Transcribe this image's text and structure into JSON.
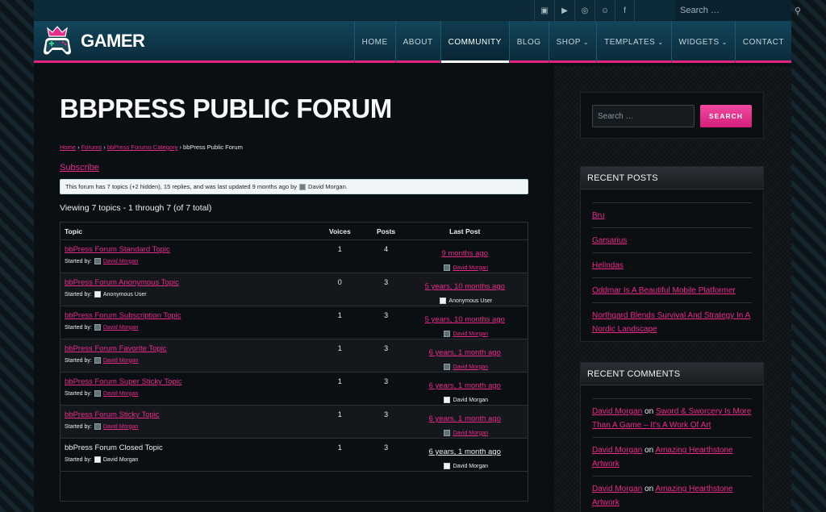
{
  "topbar": {
    "social": [
      {
        "icon": "twitch-icon",
        "glyph": "▣"
      },
      {
        "icon": "youtube-icon",
        "glyph": "▶"
      },
      {
        "icon": "steam-icon",
        "glyph": "◎"
      },
      {
        "icon": "discord-icon",
        "glyph": "☺"
      },
      {
        "icon": "facebook-icon",
        "glyph": "f"
      }
    ],
    "search_placeholder": "Search …"
  },
  "header": {
    "logo_text": "GAMER",
    "nav": [
      {
        "label": "HOME",
        "caret": false,
        "active": false
      },
      {
        "label": "ABOUT",
        "caret": false,
        "active": false
      },
      {
        "label": "COMMUNITY",
        "caret": false,
        "active": true
      },
      {
        "label": "BLOG",
        "caret": false,
        "active": false
      },
      {
        "label": "SHOP",
        "caret": true,
        "active": false
      },
      {
        "label": "TEMPLATES",
        "caret": true,
        "active": false
      },
      {
        "label": "WIDGETS",
        "caret": true,
        "active": false
      },
      {
        "label": "CONTACT",
        "caret": false,
        "active": false
      }
    ]
  },
  "main": {
    "title": "BBPRESS PUBLIC FORUM",
    "breadcrumb": {
      "home": "Home",
      "forums": "Forums",
      "category": "bbPress Forums Category",
      "current": "bbPress Public Forum",
      "sep": "›"
    },
    "subscribe": "Subscribe",
    "notice": {
      "text": "This forum has 7 topics (+2 hidden), 15 replies, and was last updated 9 months ago by",
      "author": "David Morgan",
      "end": "."
    },
    "viewing": "Viewing 7 topics - 1 through 7 (of 7 total)",
    "table": {
      "headers": {
        "topic": "Topic",
        "voices": "Voices",
        "posts": "Posts",
        "last": "Last Post"
      },
      "started_label": "Started by:",
      "rows": [
        {
          "title": "bbPress Forum Standard Topic",
          "title_link": true,
          "author": "David Morgan",
          "author_link": true,
          "voices": "1",
          "posts": "4",
          "last": "9 months ago",
          "last_link": true,
          "last_author": "David Morgan",
          "last_author_link": true
        },
        {
          "title": "bbPress Forum Anonymous Topic",
          "title_link": true,
          "author": "Anonymous User",
          "author_link": false,
          "voices": "0",
          "posts": "3",
          "last": "5 years, 10 months ago",
          "last_link": true,
          "last_author": "Anonymous User",
          "last_author_link": false
        },
        {
          "title": "bbPress Forum Subscription Topic",
          "title_link": true,
          "author": "David Morgan",
          "author_link": true,
          "voices": "1",
          "posts": "3",
          "last": "5 years, 10 months ago",
          "last_link": true,
          "last_author": "David Morgan",
          "last_author_link": true
        },
        {
          "title": "bbPress Forum Favorite Topic",
          "title_link": true,
          "author": "David Morgan",
          "author_link": true,
          "voices": "1",
          "posts": "3",
          "last": "6 years, 1 month ago",
          "last_link": true,
          "last_author": "David Morgan",
          "last_author_link": true
        },
        {
          "title": "bbPress Forum Super Sticky Topic",
          "title_link": true,
          "author": "David Morgan",
          "author_link": true,
          "voices": "1",
          "posts": "3",
          "last": "6 years, 1 month ago",
          "last_link": true,
          "last_author": "David Morgan",
          "last_author_link": false
        },
        {
          "title": "bbPress Forum Sticky Topic",
          "title_link": true,
          "author": "David Morgan",
          "author_link": true,
          "voices": "1",
          "posts": "3",
          "last": "6 years, 1 month ago",
          "last_link": true,
          "last_author": "David Morgan",
          "last_author_link": true
        },
        {
          "title": "bbPress Forum Closed Topic",
          "title_link": false,
          "author": "David Morgan",
          "author_link": false,
          "voices": "1",
          "posts": "3",
          "last": "6 years, 1 month ago",
          "last_link": false,
          "last_author": "David Morgan",
          "last_author_link": false
        }
      ]
    }
  },
  "sidebar": {
    "search_placeholder": "Search …",
    "search_button": "SEARCH",
    "recent_posts": {
      "title": "RECENT POSTS",
      "items": [
        "Bru",
        "Garsarius",
        "Helindas",
        "Oddmar Is A Beautiful Mobile Platformer",
        "Northgard Blends Survival And Strategy In A Nordic Landscape"
      ]
    },
    "recent_comments": {
      "title": "RECENT COMMENTS",
      "on": "on",
      "items": [
        {
          "author": "David Morgan",
          "post": "Sword & Sworcery Is More Than A Game – It's A Work Of Art"
        },
        {
          "author": "David Morgan",
          "post": "Amazing Hearthstone Artwork"
        },
        {
          "author": "David Morgan",
          "post": "Amazing Hearthstone Artwork"
        }
      ]
    }
  },
  "colors": {
    "accent": "#ea2a8b",
    "header_bg": "#12455b",
    "page_bg": "#0a0f13"
  }
}
